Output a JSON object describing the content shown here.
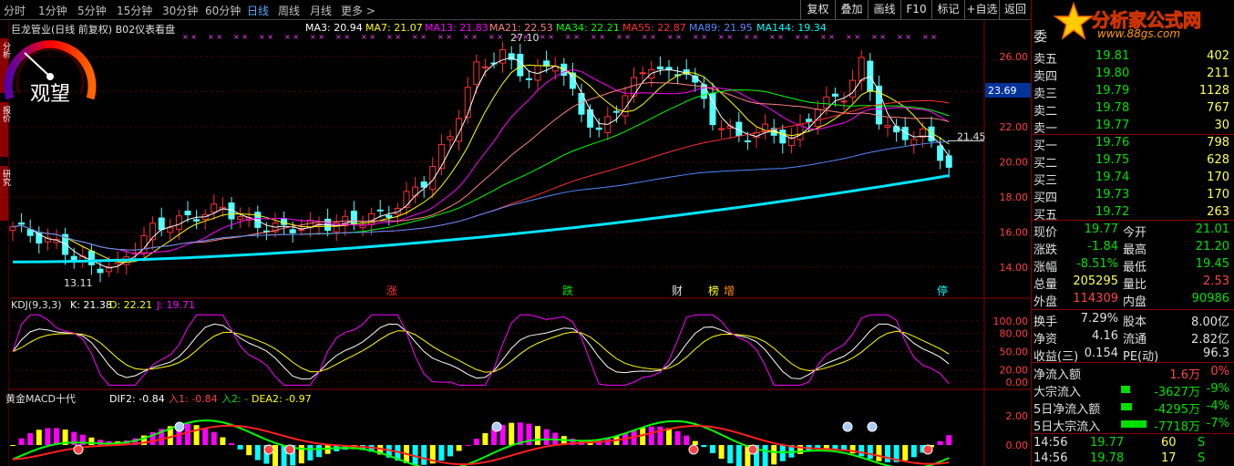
{
  "toolbar": {
    "timeframes": [
      "分时",
      "1分钟",
      "5分钟",
      "15分钟",
      "30分钟",
      "60分钟",
      "日线",
      "周线",
      "月线",
      "更多 >"
    ],
    "active": "日线",
    "buttons": [
      "复权",
      "叠加",
      "画线",
      "F10",
      "标记",
      "+自选",
      "返回"
    ]
  },
  "left_tabs": [
    "分析",
    "报价",
    "研究"
  ],
  "stock": {
    "title": "巨龙管业(日线 前复权) B02仪表看盘"
  },
  "ma": [
    {
      "label": "MA3: 20.94",
      "color": "#ffffff"
    },
    {
      "label": "MA7: 21.07",
      "color": "#ffff00"
    },
    {
      "label": "MA13: 21.83",
      "color": "#ff00ff"
    },
    {
      "label": "MA21: 22.53",
      "color": "#ff8080"
    },
    {
      "label": "MA34: 22.21",
      "color": "#00ff00"
    },
    {
      "label": "MA55: 22.87",
      "color": "#ff3030"
    },
    {
      "label": "MA89: 21.95",
      "color": "#5588ff"
    },
    {
      "label": "MA144: 19.34",
      "color": "#00ffff"
    }
  ],
  "price_axis": [
    "26.00",
    "24.00",
    "22.00",
    "20.00",
    "18.00",
    "16.00",
    "14.00"
  ],
  "crosshair_price": "23.69",
  "annotations": {
    "high": "27.10",
    "low": "13.11",
    "last": "21.45"
  },
  "event_tags": [
    {
      "t": "涨",
      "c": "#ff3030"
    },
    {
      "t": "跌",
      "c": "#00e000"
    },
    {
      "t": "财",
      "c": "#e0e0e0"
    },
    {
      "t": "榜",
      "c": "#ffff00"
    },
    {
      "t": "增",
      "c": "#ff8c00"
    },
    {
      "t": "停",
      "c": "#00ffff"
    }
  ],
  "gauge": {
    "label": "观望"
  },
  "kdj": {
    "title": "KDJ(9,3,3)",
    "k": "K: 21.38",
    "d": "D: 22.21",
    "j": "J: 19.71",
    "axis": [
      "100.00",
      "80.00",
      "50.00",
      "20.00",
      "0.00"
    ]
  },
  "macd": {
    "title": "黄金MACD十代",
    "dif": "DIF2: -0.84",
    "in1": "入1: -0.84",
    "in2": "入2: -",
    "dea": "DEA2: -0.97",
    "axis": [
      "2.00",
      "0.00"
    ]
  },
  "logo": {
    "title": "分析家公式网",
    "url": "www.88gs.com"
  },
  "orderbook": {
    "sell": [
      {
        "label": "卖五",
        "price": "19.81",
        "vol": "402"
      },
      {
        "label": "卖四",
        "price": "19.80",
        "vol": "211"
      },
      {
        "label": "卖三",
        "price": "19.79",
        "vol": "1128"
      },
      {
        "label": "卖二",
        "price": "19.78",
        "vol": "767"
      },
      {
        "label": "卖一",
        "price": "19.77",
        "vol": "30"
      }
    ],
    "buy": [
      {
        "label": "买一",
        "price": "19.76",
        "vol": "798"
      },
      {
        "label": "买二",
        "price": "19.75",
        "vol": "628"
      },
      {
        "label": "买三",
        "price": "19.74",
        "vol": "170"
      },
      {
        "label": "买四",
        "price": "19.73",
        "vol": "170"
      },
      {
        "label": "买五",
        "price": "19.72",
        "vol": "263"
      }
    ],
    "top_label": "委"
  },
  "quote": [
    {
      "l1": "现价",
      "v1": "19.77",
      "c1": "gr",
      "l2": "今开",
      "v2": "21.01",
      "c2": "gr"
    },
    {
      "l1": "涨跌",
      "v1": "-1.84",
      "c1": "gr",
      "l2": "最高",
      "v2": "21.20",
      "c2": "gr"
    },
    {
      "l1": "涨幅",
      "v1": "-8.51%",
      "c1": "gr",
      "l2": "最低",
      "v2": "19.45",
      "c2": "gr"
    },
    {
      "l1": "总量",
      "v1": "205295",
      "c1": "ye",
      "l2": "量比",
      "v2": "2.53",
      "c2": "pr"
    },
    {
      "l1": "外盘",
      "v1": "114309",
      "c1": "pr",
      "l2": "内盘",
      "v2": "90986",
      "c2": "gr"
    }
  ],
  "finance": [
    {
      "l1": "换手",
      "v1": "7.29%",
      "l2": "股本",
      "v2": "8.00亿"
    },
    {
      "l1": "净资",
      "v1": "4.16",
      "l2": "流通",
      "v2": "2.82亿"
    },
    {
      "l1": "收益(三)",
      "v1": "0.154",
      "l2": "PE(动)",
      "v2": "96.3"
    }
  ],
  "flows": [
    {
      "label": "净流入额",
      "value": "1.6万",
      "pct": "0%",
      "color": "#ff4444",
      "bar": 0
    },
    {
      "label": "大宗流入",
      "value": "-3627万",
      "pct": "-9%",
      "color": "#00e000",
      "bar": 0.25
    },
    {
      "label": "5日净流入额",
      "value": "-4295万",
      "pct": "-4%",
      "color": "#00e000",
      "bar": 0.3
    },
    {
      "label": "5日大宗流入",
      "value": "-7718万",
      "pct": "-7%",
      "color": "#00e000",
      "bar": 0.7
    }
  ],
  "ticks": [
    {
      "time": "14:56",
      "price": "19.77",
      "vol": "60",
      "dir": "S"
    },
    {
      "time": "14:56",
      "price": "19.78",
      "vol": "17",
      "dir": "S"
    }
  ]
}
